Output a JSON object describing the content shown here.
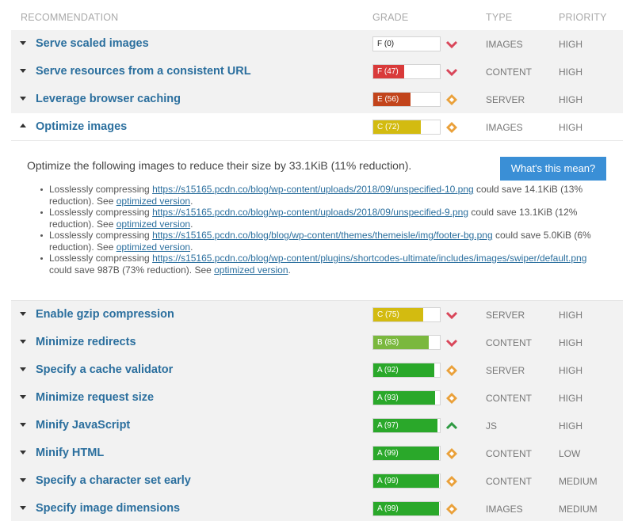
{
  "header": {
    "recommendation": "RECOMMENDATION",
    "grade": "GRADE",
    "type": "TYPE",
    "priority": "PRIORITY"
  },
  "colors": {
    "link": "#2b6f9e",
    "grade_f": "#d93a3a",
    "grade_e": "#c2441b",
    "grade_c": "#d3bb10",
    "grade_b": "#7ab83e",
    "grade_a": "#2aa82a",
    "indicator_red": "#d9475a",
    "indicator_orange": "#eaa13b",
    "indicator_green": "#2f9a43",
    "button": "#3a8fd6"
  },
  "rows": [
    {
      "title": "Serve scaled images",
      "grade": "F (0)",
      "grade_pct": 0,
      "grade_color": "#ffffff",
      "dark_label": true,
      "indicator": "chevron-down-red-icon",
      "type": "IMAGES",
      "priority": "HIGH",
      "expanded": false
    },
    {
      "title": "Serve resources from a consistent URL",
      "grade": "F (47)",
      "grade_pct": 47,
      "grade_color": "#d93a3a",
      "dark_label": false,
      "indicator": "chevron-down-red-icon",
      "type": "CONTENT",
      "priority": "HIGH",
      "expanded": false
    },
    {
      "title": "Leverage browser caching",
      "grade": "E (56)",
      "grade_pct": 56,
      "grade_color": "#c2441b",
      "dark_label": false,
      "indicator": "diamond-orange-icon",
      "type": "SERVER",
      "priority": "HIGH",
      "expanded": false
    },
    {
      "title": "Optimize images",
      "grade": "C (72)",
      "grade_pct": 72,
      "grade_color": "#d3bb10",
      "dark_label": false,
      "indicator": "diamond-orange-icon",
      "type": "IMAGES",
      "priority": "HIGH",
      "expanded": true
    },
    {
      "title": "Enable gzip compression",
      "grade": "C (75)",
      "grade_pct": 75,
      "grade_color": "#d3bb10",
      "dark_label": false,
      "indicator": "chevron-down-red-icon",
      "type": "SERVER",
      "priority": "HIGH",
      "expanded": false
    },
    {
      "title": "Minimize redirects",
      "grade": "B (83)",
      "grade_pct": 83,
      "grade_color": "#7ab83e",
      "dark_label": false,
      "indicator": "chevron-down-red-icon",
      "type": "CONTENT",
      "priority": "HIGH",
      "expanded": false
    },
    {
      "title": "Specify a cache validator",
      "grade": "A (92)",
      "grade_pct": 92,
      "grade_color": "#2aa82a",
      "dark_label": false,
      "indicator": "diamond-orange-icon",
      "type": "SERVER",
      "priority": "HIGH",
      "expanded": false
    },
    {
      "title": "Minimize request size",
      "grade": "A (93)",
      "grade_pct": 93,
      "grade_color": "#2aa82a",
      "dark_label": false,
      "indicator": "diamond-orange-icon",
      "type": "CONTENT",
      "priority": "HIGH",
      "expanded": false
    },
    {
      "title": "Minify JavaScript",
      "grade": "A (97)",
      "grade_pct": 97,
      "grade_color": "#2aa82a",
      "dark_label": false,
      "indicator": "chevron-up-green-icon",
      "type": "JS",
      "priority": "HIGH",
      "expanded": false
    },
    {
      "title": "Minify HTML",
      "grade": "A (99)",
      "grade_pct": 99,
      "grade_color": "#2aa82a",
      "dark_label": false,
      "indicator": "diamond-orange-icon",
      "type": "CONTENT",
      "priority": "LOW",
      "expanded": false
    },
    {
      "title": "Specify a character set early",
      "grade": "A (99)",
      "grade_pct": 99,
      "grade_color": "#2aa82a",
      "dark_label": false,
      "indicator": "diamond-orange-icon",
      "type": "CONTENT",
      "priority": "MEDIUM",
      "expanded": false
    },
    {
      "title": "Specify image dimensions",
      "grade": "A (99)",
      "grade_pct": 99,
      "grade_color": "#2aa82a",
      "dark_label": false,
      "indicator": "diamond-orange-icon",
      "type": "IMAGES",
      "priority": "MEDIUM",
      "expanded": false
    }
  ],
  "detail": {
    "summary": "Optimize the following images to reduce their size by 33.1KiB (11% reduction).",
    "button_label": "What's this mean?",
    "items": [
      {
        "prefix": "Losslessly compressing ",
        "url": "https://s15165.pcdn.co/blog/wp-content/uploads/2018/09/unspecified-10.png",
        "suffix": " could save 14.1KiB (13% reduction). See ",
        "link": "optimized version",
        "end": "."
      },
      {
        "prefix": "Losslessly compressing ",
        "url": "https://s15165.pcdn.co/blog/wp-content/uploads/2018/09/unspecified-9.png",
        "suffix": " could save 13.1KiB (12% reduction). See ",
        "link": "optimized version",
        "end": "."
      },
      {
        "prefix": "Losslessly compressing ",
        "url": "https://s15165.pcdn.co/blog/blog/wp-content/themes/themeisle/img/footer-bg.png",
        "suffix": " could save 5.0KiB (6% reduction). See ",
        "link": "optimized version",
        "end": "."
      },
      {
        "prefix": "Losslessly compressing ",
        "url": "https://s15165.pcdn.co/blog/wp-content/plugins/shortcodes-ultimate/includes/images/swiper/default.png",
        "suffix": " could save 987B (73% reduction). See ",
        "link": "optimized version",
        "end": "."
      }
    ]
  }
}
